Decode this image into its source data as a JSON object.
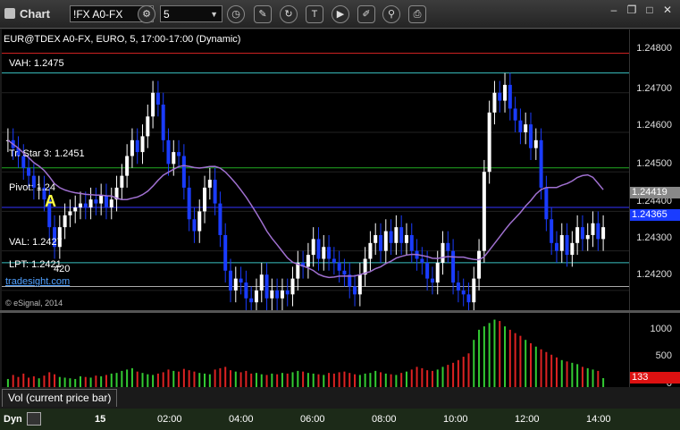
{
  "app": {
    "title": "Chart"
  },
  "toolbar": {
    "symbol": "!FX A0-FX",
    "interval": "5",
    "tools": [
      "cursor-sync-icon",
      "clock-icon",
      "pencil-icon",
      "refresh-icon",
      "text-tool-icon",
      "play-icon",
      "edit-icon",
      "link-icon",
      "print-icon"
    ]
  },
  "chart_header": {
    "title": "EUR@TDEX A0-FX, EURO, 5, 17:00-17:00 (Dynamic)"
  },
  "levels": [
    {
      "label": "VAH: 1.2475",
      "color": "#39c0c0"
    },
    {
      "label": "Tr. Star 3: 1.2451",
      "color": "#22aa22"
    },
    {
      "label": "Pivot: 1.24",
      "color": "#3333ff"
    },
    {
      "label": "VAL: 1.2427",
      "color": "#39c0c0"
    },
    {
      "label": "LPT: 1.2421",
      "color": "#aaaaaa"
    }
  ],
  "extra_labels": {
    "lpt_value": "420",
    "a_marker": "A",
    "branding": "tradesight.com",
    "copyright": "© eSignal, 2014"
  },
  "price_axis": {
    "ticks": [
      "1.24800",
      "1.24700",
      "1.24600",
      "1.24500",
      "1.24400",
      "1.24300",
      "1.24200"
    ],
    "marker_last": "1.24419",
    "marker_low": "1.24365"
  },
  "volume_axis": {
    "ticks": [
      "1000",
      "500",
      "0"
    ],
    "marker": "133"
  },
  "volume_tab": {
    "label": "Vol (current price bar)"
  },
  "time_axis": {
    "ticks": [
      "15",
      "02:00",
      "04:00",
      "06:00",
      "08:00",
      "10:00",
      "12:00",
      "14:00"
    ],
    "mode": "Dyn"
  },
  "chart_data": {
    "type": "candlestick",
    "title": "EUR@TDEX A0-FX, EURO, 5, 17:00-17:00 (Dynamic)",
    "ylim": [
      1.2415,
      1.2486
    ],
    "closes": [
      1.2458,
      1.2456,
      1.2454,
      1.2451,
      1.2449,
      1.2446,
      1.2446,
      1.2443,
      1.2436,
      1.2431,
      1.2436,
      1.2439,
      1.244,
      1.2441,
      1.2442,
      1.2441,
      1.2443,
      1.2442,
      1.2444,
      1.2441,
      1.2443,
      1.2446,
      1.2449,
      1.2454,
      1.2458,
      1.2455,
      1.2459,
      1.2464,
      1.247,
      1.2467,
      1.2458,
      1.2452,
      1.2455,
      1.2454,
      1.2446,
      1.2438,
      1.2435,
      1.244,
      1.2446,
      1.2448,
      1.2442,
      1.2434,
      1.2425,
      1.242,
      1.2423,
      1.2422,
      1.2418,
      1.2417,
      1.242,
      1.2424,
      1.2418,
      1.242,
      1.2418,
      1.242,
      1.2419,
      1.2423,
      1.2427,
      1.2426,
      1.2429,
      1.2433,
      1.2428,
      1.2431,
      1.2428,
      1.2427,
      1.2425,
      1.2424,
      1.2421,
      1.2419,
      1.2424,
      1.2428,
      1.2432,
      1.2434,
      1.243,
      1.2435,
      1.2432,
      1.2436,
      1.2432,
      1.2434,
      1.243,
      1.2428,
      1.2427,
      1.2423,
      1.2422,
      1.2427,
      1.2432,
      1.243,
      1.2422,
      1.242,
      1.2419,
      1.2417,
      1.2423,
      1.243,
      1.245,
      1.2465,
      1.247,
      1.2468,
      1.2472,
      1.2466,
      1.2463,
      1.246,
      1.2462,
      1.2456,
      1.2458,
      1.2446,
      1.2438,
      1.2432,
      1.243,
      1.2434,
      1.2429,
      1.2432,
      1.2436,
      1.2433,
      1.2434,
      1.2437,
      1.2433,
      1.2436
    ],
    "volume": [
      120,
      180,
      150,
      200,
      140,
      160,
      130,
      170,
      220,
      190,
      150,
      140,
      130,
      120,
      160,
      150,
      140,
      170,
      160,
      180,
      200,
      210,
      240,
      260,
      280,
      230,
      210,
      190,
      180,
      200,
      220,
      260,
      240,
      230,
      270,
      250,
      230,
      210,
      200,
      190,
      260,
      280,
      300,
      250,
      230,
      220,
      240,
      200,
      210,
      190,
      180,
      200,
      190,
      210,
      200,
      220,
      240,
      230,
      210,
      200,
      190,
      180,
      210,
      200,
      220,
      230,
      210,
      190,
      180,
      200,
      210,
      240,
      220,
      200,
      190,
      180,
      210,
      230,
      260,
      300,
      280,
      250,
      240,
      260,
      300,
      330,
      360,
      400,
      450,
      500,
      700,
      850,
      900,
      950,
      1000,
      980,
      900,
      850,
      800,
      760,
      700,
      650,
      600,
      560,
      520,
      480,
      440,
      400,
      380,
      360,
      340,
      300,
      280,
      260,
      240,
      133
    ],
    "volume_ylim": [
      0,
      1100
    ]
  }
}
